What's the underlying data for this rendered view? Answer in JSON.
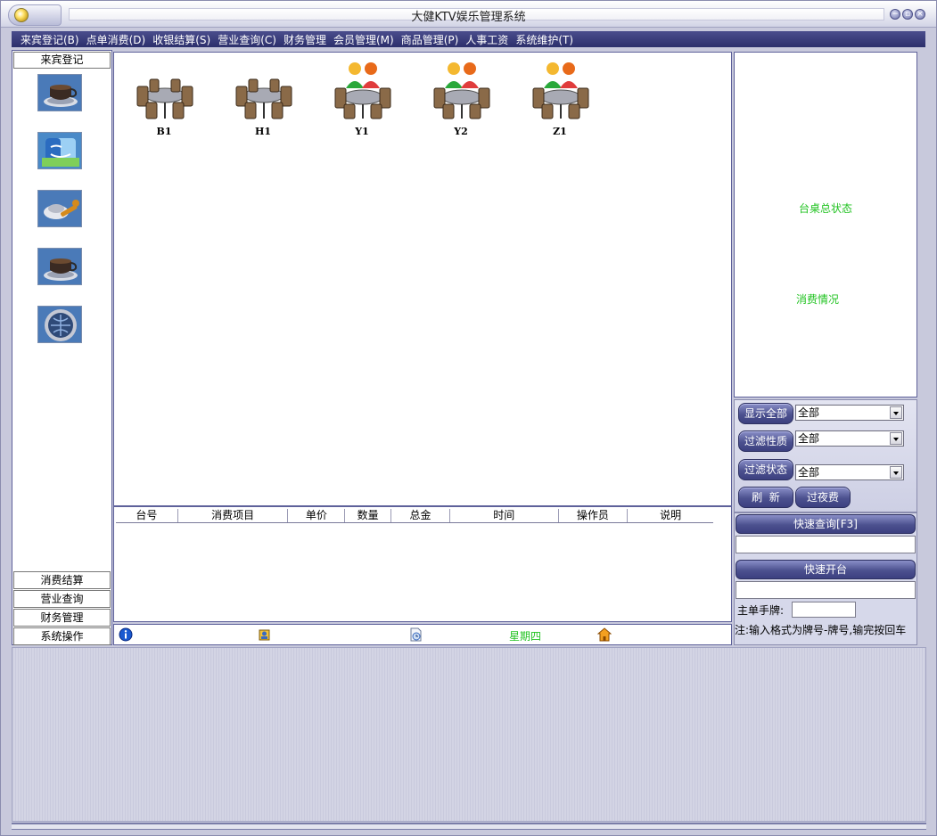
{
  "window": {
    "title": "大健KTV娱乐管理系统"
  },
  "menu": [
    "来宾登记(B)",
    "点单消费(D)",
    "收银结算(S)",
    "营业查询(C)",
    "财务管理",
    "会员管理(M)",
    "商品管理(P)",
    "人事工资",
    "系统维护(T)"
  ],
  "left_nav": {
    "header": "来宾登记",
    "icons": [
      "coffee-cup-icon",
      "finder-folder-icon",
      "tools-icon",
      "coffee-cup-icon",
      "globe-button-icon"
    ],
    "footer": [
      "消费结算",
      "营业查询",
      "财务管理",
      "系统操作"
    ]
  },
  "tables": [
    {
      "label": "B1",
      "occupied": false
    },
    {
      "label": "H1",
      "occupied": false
    },
    {
      "label": "Y1",
      "occupied": true
    },
    {
      "label": "Y2",
      "occupied": true
    },
    {
      "label": "Z1",
      "occupied": true
    }
  ],
  "detail_columns": [
    "台号",
    "消费项目",
    "单价",
    "数量",
    "总金",
    "时间",
    "操作员",
    "说明"
  ],
  "status_bar": {
    "weekday": "星期四"
  },
  "right_panel": {
    "status_title": "台桌总状态",
    "consumption_title": "消费情况",
    "show_all_label": "显示全部",
    "filter_nature_label": "过滤性质",
    "filter_status_label": "过滤状态",
    "refresh_label": "刷  新",
    "night_fee_label": "过夜费",
    "show_all_value": "全部",
    "filter_nature_value": "全部",
    "filter_status_value": "全部",
    "quick_query_label": "快速查询[F3]",
    "quick_open_label": "快速开台",
    "hand_card_label": "主单手牌:",
    "note": "注:输入格式为牌号-牌号,输完按回车"
  },
  "colors": {
    "accent_green": "#22c322",
    "menu_bg": "#2c2f6c"
  }
}
